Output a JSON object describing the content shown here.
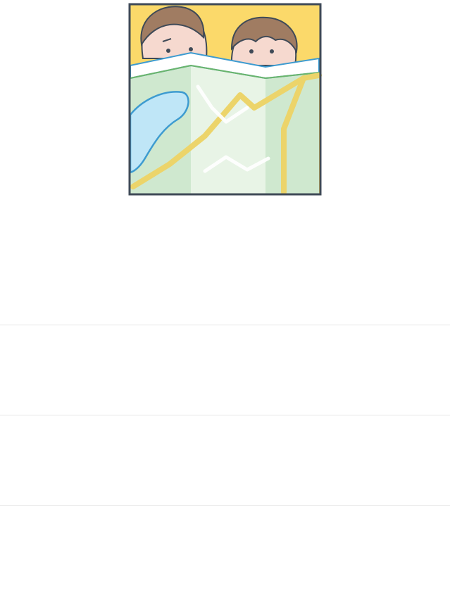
{
  "hero": {
    "icon": "map-reading-illustration-icon",
    "colors": {
      "sky": "#fbd96a",
      "map_green": "#cfe8cf",
      "map_light": "#e8f4e6",
      "water": "#bfe6f7",
      "water_stroke": "#3d9bd0",
      "road": "#ecd46a",
      "frame": "#3f4a57",
      "hair": "#a07c62",
      "skin": "#f6d9cf"
    }
  },
  "list": {
    "rows": [
      {
        "label": ""
      },
      {
        "label": ""
      },
      {
        "label": ""
      }
    ],
    "divider_color": "#e6e6e6"
  }
}
